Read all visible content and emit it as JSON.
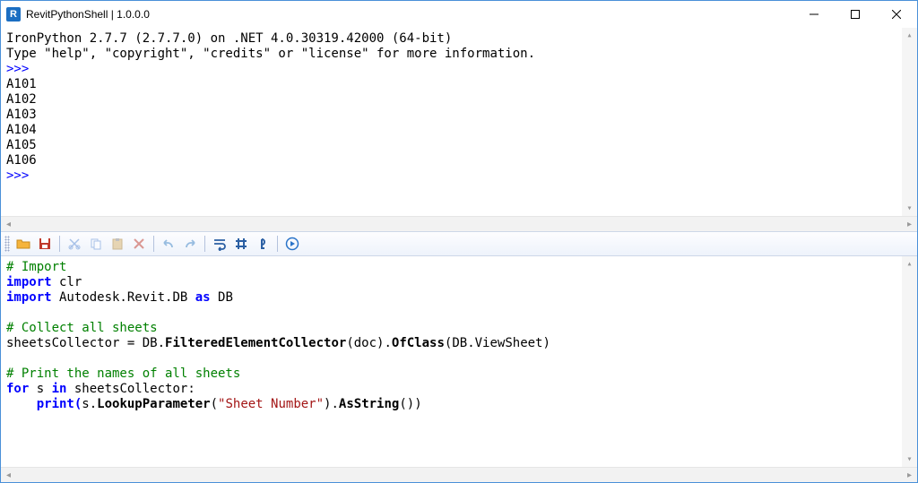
{
  "window": {
    "app_icon_letter": "R",
    "title": "RevitPythonShell | 1.0.0.0"
  },
  "output": {
    "banner_line1": "IronPython 2.7.7 (2.7.7.0) on .NET 4.0.30319.42000 (64-bit)",
    "banner_line2": "Type \"help\", \"copyright\", \"credits\" or \"license\" for more information.",
    "prompt": ">>> ",
    "results": [
      "A101",
      "A102",
      "A103",
      "A104",
      "A105",
      "A106"
    ]
  },
  "toolbar": {
    "open": "open-icon",
    "save": "save-icon",
    "cut": "cut-icon",
    "copy": "copy-icon",
    "paste": "paste-icon",
    "delete": "delete-icon",
    "undo": "undo-icon",
    "redo": "redo-icon",
    "wordwrap": "wordwrap-icon",
    "grid": "grid-icon",
    "pilcrow": "pilcrow-icon",
    "run": "run-icon"
  },
  "code": {
    "c1": "# Import",
    "k_import": "import",
    "m_clr": " clr",
    "m_autodesk": " Autodesk.Revit.DB ",
    "k_as": "as",
    "m_db": " DB",
    "c2": "# Collect all sheets",
    "lhs": "sheetsCollector = DB.",
    "fec": "FilteredElementCollector",
    "args1": "(doc).",
    "ofclass": "OfClass",
    "args2": "(DB.ViewSheet)",
    "c3": "# Print the names of all sheets",
    "k_for": "for",
    "loop_mid": " s ",
    "k_in": "in",
    "loop_tail": " sheetsCollector:",
    "indent": "    ",
    "print_open": "print(",
    "s_lookup": "s.",
    "lookup": "LookupParameter",
    "str_open": "(",
    "str_lit": "\"Sheet Number\"",
    "str_close": ").",
    "asstring": "AsString",
    "tail": "())"
  }
}
